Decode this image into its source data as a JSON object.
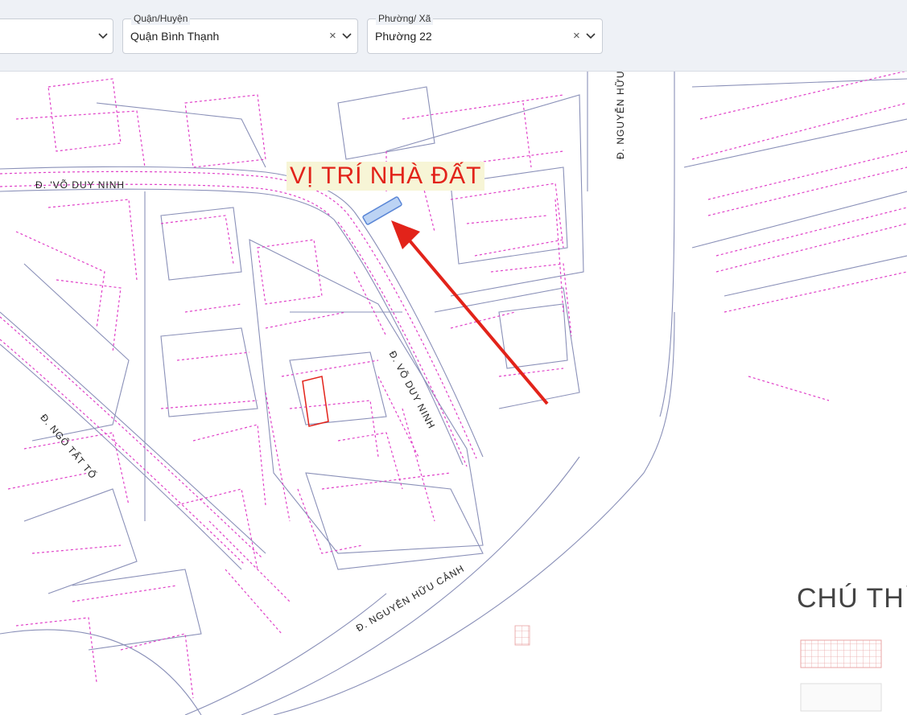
{
  "filters": {
    "district_label": "Quận/Huyện",
    "district_value": "Quận Bình Thạnh",
    "ward_label": "Phường/ Xã",
    "ward_value": "Phường 22"
  },
  "map": {
    "headline": "VỊ TRÍ NHÀ ĐẤT",
    "streets": {
      "vo_duy_ninh_west": "Đ. 'VÕ DUY NINH",
      "vo_duy_ninh_diag": "Đ. VÕ DUY NINH",
      "ngo_tat_to": "Đ. NGÔ TẤT TỐ",
      "nguyen_huu_canh_south": "Đ. NGUYỄN HỮU CẢNH",
      "nguyen_huu_canh_north": "Đ. NGUYỄN HỮU C"
    },
    "legend_title": "CHÚ THÍC",
    "colors": {
      "parcel_lines": "#e040c8",
      "road_lines": "#8a90b8",
      "arrow": "#e2231a",
      "marker": "#7da6e3"
    }
  }
}
